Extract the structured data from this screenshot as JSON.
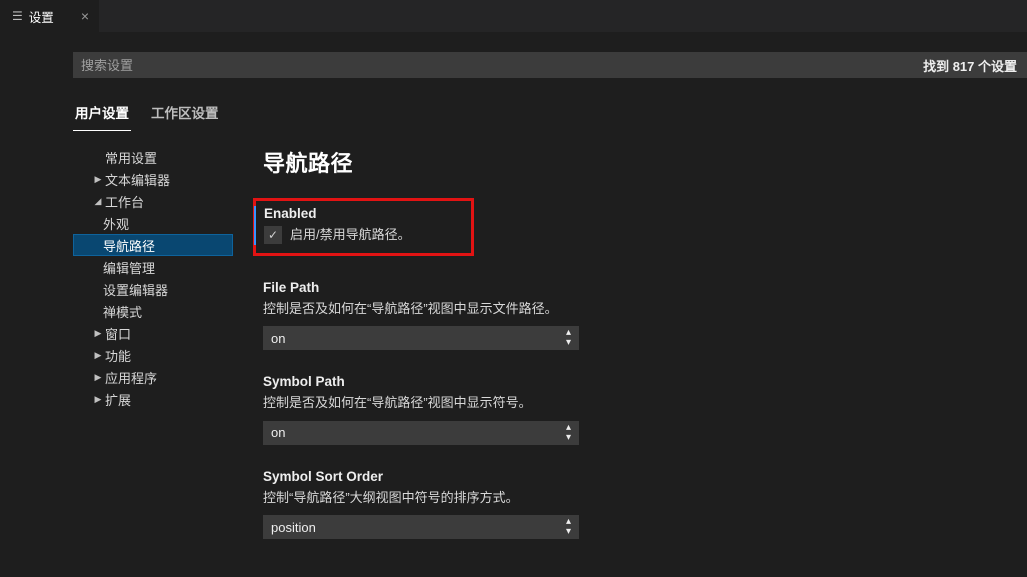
{
  "tab": {
    "label": "设置"
  },
  "search": {
    "placeholder": "搜索设置"
  },
  "resultCount": "找到 817 个设置",
  "scopeTabs": {
    "user": "用户设置",
    "workspace": "工作区设置"
  },
  "toc": {
    "items": [
      {
        "label": "常用设置",
        "depth": 1,
        "twisty": ""
      },
      {
        "label": "文本编辑器",
        "depth": 1,
        "twisty": "▶"
      },
      {
        "label": "工作台",
        "depth": 1,
        "twisty": "◢"
      },
      {
        "label": "外观",
        "depth": 2,
        "twisty": ""
      },
      {
        "label": "导航路径",
        "depth": 2,
        "twisty": "",
        "selected": true
      },
      {
        "label": "编辑管理",
        "depth": 2,
        "twisty": ""
      },
      {
        "label": "设置编辑器",
        "depth": 2,
        "twisty": ""
      },
      {
        "label": "禅模式",
        "depth": 2,
        "twisty": ""
      },
      {
        "label": "窗口",
        "depth": 1,
        "twisty": "▶"
      },
      {
        "label": "功能",
        "depth": 1,
        "twisty": "▶"
      },
      {
        "label": "应用程序",
        "depth": 1,
        "twisty": "▶"
      },
      {
        "label": "扩展",
        "depth": 1,
        "twisty": "▶"
      }
    ]
  },
  "section": {
    "title": "导航路径"
  },
  "settings": {
    "enabled": {
      "name": "Enabled",
      "desc": "启用/禁用导航路径。",
      "checked": true
    },
    "filePath": {
      "name": "File Path",
      "desc": "控制是否及如何在“导航路径”视图中显示文件路径。",
      "value": "on"
    },
    "symbolPath": {
      "name": "Symbol Path",
      "desc": "控制是否及如何在“导航路径”视图中显示符号。",
      "value": "on"
    },
    "symbolSortOrder": {
      "name": "Symbol Sort Order",
      "desc": "控制“导航路径”大纲视图中符号的排序方式。",
      "value": "position"
    }
  }
}
